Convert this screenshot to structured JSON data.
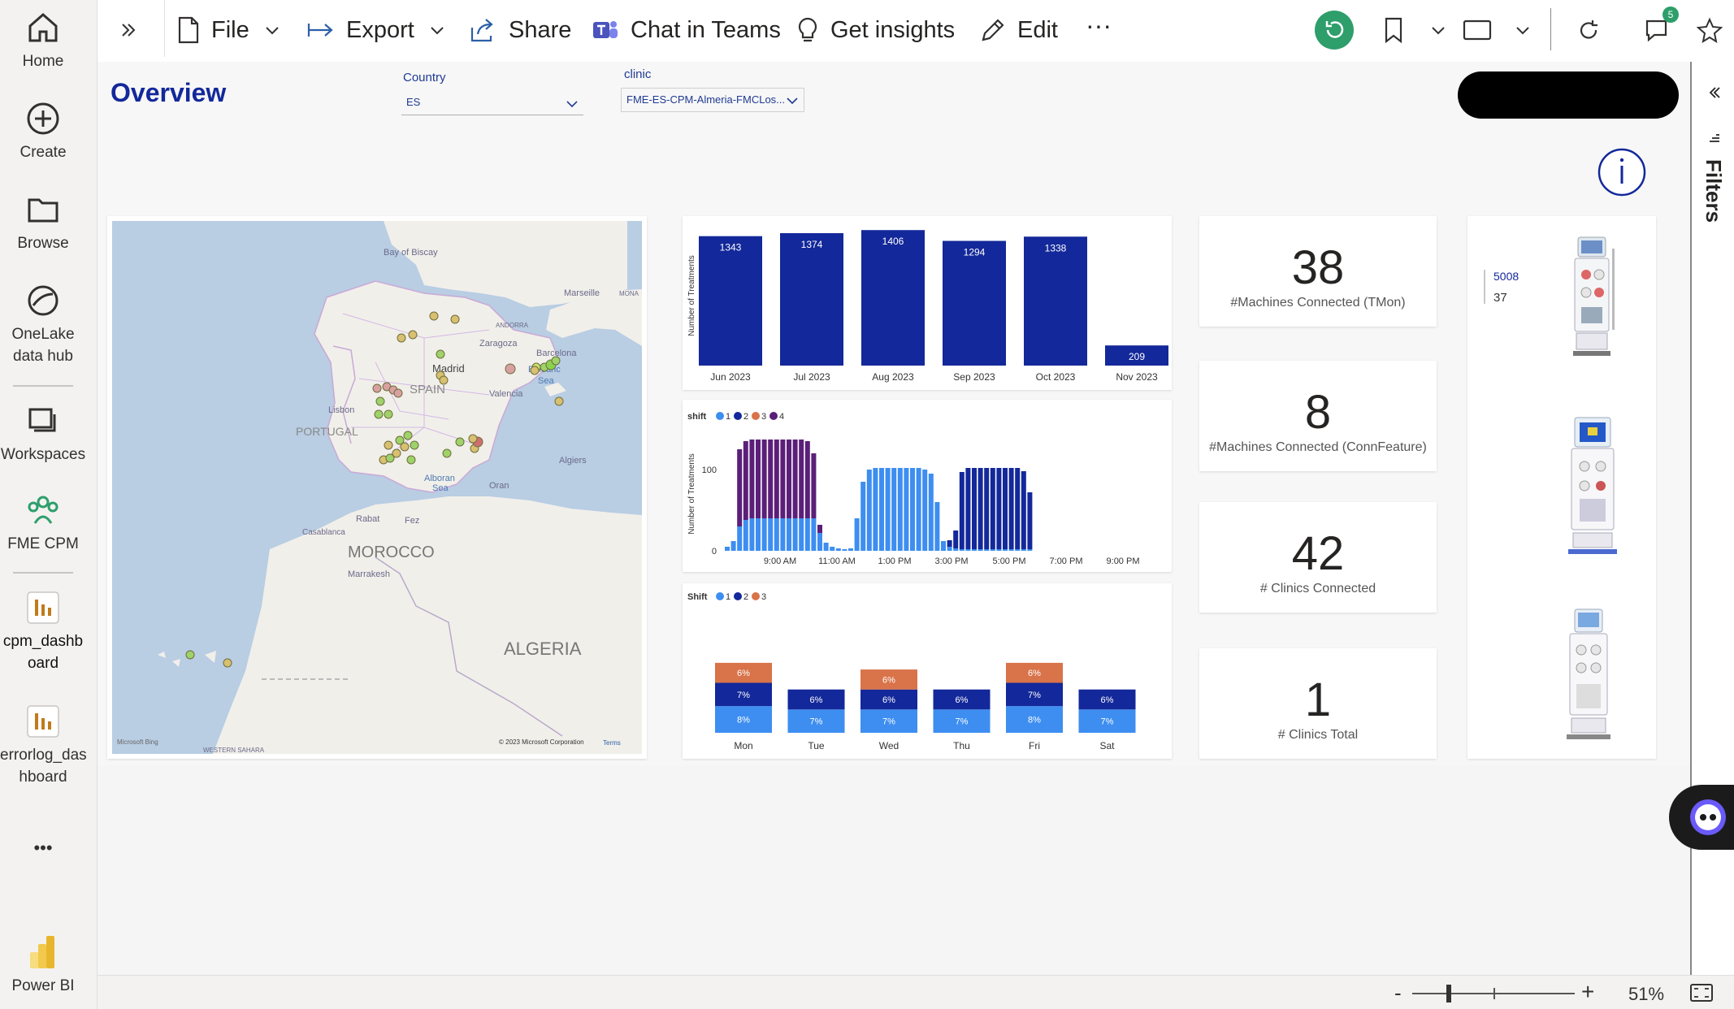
{
  "nav": {
    "home": "Home",
    "create": "Create",
    "browse": "Browse",
    "onelake": [
      "OneLake",
      "data hub"
    ],
    "workspaces": "Workspaces",
    "fme_cpm": "FME CPM",
    "cpm_dashboard": [
      "cpm_dashb",
      "oard"
    ],
    "errorlog": [
      "errorlog_das",
      "hboard"
    ],
    "more": "•••",
    "powerbi": "Power BI"
  },
  "toolbar": {
    "file": "File",
    "export": "Export",
    "share": "Share",
    "chat": "Chat in Teams",
    "insights": "Get insights",
    "edit": "Edit",
    "more": "···",
    "comments_badge": "5"
  },
  "report": {
    "title": "Overview",
    "country_label": "Country",
    "country_value": "ES",
    "clinic_label": "clinic",
    "clinic_value": "FME-ES-CPM-Almeria-FMCLos..."
  },
  "map": {
    "labels": [
      "Bay of Biscay",
      "Marseille",
      "MONA",
      "ANDORRA",
      "Zaragoza",
      "Barcelona",
      "Madrid",
      "SPAIN",
      "Balearic",
      "Sea",
      "Valencia",
      "Lisbon",
      "PORTUGAL",
      "Alboran",
      "Sea",
      "Algiers",
      "Oran",
      "Rabat",
      "Fez",
      "Casablanca",
      "MOROCCO",
      "Marrakesh",
      "ALGERIA",
      "WESTERN SAHARA"
    ],
    "attribution": "© 2023 Microsoft Corporation",
    "terms": "Terms",
    "bing": "Microsoft Bing"
  },
  "kpis": [
    {
      "value": "38",
      "label": "#Machines Connected (TMon)"
    },
    {
      "value": "8",
      "label": "#Machines Connected (ConnFeature)"
    },
    {
      "value": "42",
      "label": "# Clinics Connected"
    },
    {
      "value": "1",
      "label": "# Clinics Total"
    }
  ],
  "machines": {
    "model": "5008",
    "count": "37"
  },
  "statusbar": {
    "zoom": "51%",
    "minus": "-",
    "plus": "+"
  },
  "filters_label": "Filters",
  "colors": {
    "navy": "#13289a",
    "blue": "#3d8ef0",
    "purple": "#5b1f7a",
    "orange": "#d9734a",
    "accent_green": "#2e9e6b"
  },
  "chart_data": [
    {
      "type": "bar",
      "ylabel": "Number of Treatments",
      "categories": [
        "Jun 2023",
        "Jul 2023",
        "Aug 2023",
        "Sep 2023",
        "Oct 2023",
        "Nov 2023"
      ],
      "values": [
        1343,
        1374,
        1406,
        1294,
        1338,
        209
      ],
      "ylim": [
        0,
        1450
      ]
    },
    {
      "type": "bar",
      "stacked": true,
      "legend_title": "shift",
      "legend": [
        "1",
        "2",
        "3",
        "4"
      ],
      "ylabel": "Number of Treatments",
      "yticks": [
        "0",
        "100"
      ],
      "xticks": [
        "9:00 AM",
        "11:00 AM",
        "1:00 PM",
        "3:00 PM",
        "5:00 PM",
        "7:00 PM",
        "9:00 PM"
      ],
      "series": [
        {
          "name": "1",
          "color": "#3d8ef0",
          "values": [
            5,
            12,
            30,
            38,
            40,
            40,
            40,
            40,
            40,
            40,
            40,
            40,
            40,
            40,
            40,
            22,
            10,
            5,
            3,
            2,
            3,
            40,
            85,
            100,
            102,
            102,
            102,
            102,
            102,
            102,
            102,
            102,
            100,
            95,
            60,
            12,
            5,
            3,
            2,
            2,
            2,
            2,
            2,
            2,
            2,
            2,
            2,
            2,
            2,
            2
          ]
        },
        {
          "name": "2",
          "color": "#13289a",
          "values": [
            0,
            0,
            0,
            0,
            0,
            0,
            0,
            0,
            0,
            0,
            0,
            0,
            0,
            0,
            0,
            0,
            0,
            0,
            0,
            0,
            0,
            0,
            0,
            0,
            0,
            0,
            0,
            0,
            0,
            0,
            0,
            0,
            0,
            0,
            0,
            0,
            8,
            22,
            95,
            100,
            100,
            100,
            100,
            100,
            100,
            100,
            100,
            100,
            96,
            70,
            0
          ]
        },
        {
          "name": "3",
          "color": "#d9734a",
          "values": []
        },
        {
          "name": "4",
          "color": "#5b1f7a",
          "values": [
            0,
            0,
            95,
            97,
            97,
            97,
            97,
            97,
            97,
            97,
            97,
            97,
            97,
            95,
            80,
            10,
            0
          ]
        }
      ]
    },
    {
      "type": "bar",
      "stacked": true,
      "legend_title": "Shift",
      "legend": [
        "1",
        "2",
        "3"
      ],
      "categories": [
        "Mon",
        "Tue",
        "Wed",
        "Thu",
        "Fri",
        "Sat"
      ],
      "series": [
        {
          "name": "1",
          "color": "#3d8ef0",
          "labels": [
            "8%",
            "7%",
            "7%",
            "7%",
            "8%",
            "7%"
          ],
          "values": [
            8,
            7,
            7,
            7,
            8,
            7
          ]
        },
        {
          "name": "2",
          "color": "#13289a",
          "labels": [
            "7%",
            "6%",
            "6%",
            "6%",
            "7%",
            "6%"
          ],
          "values": [
            7,
            6,
            6,
            6,
            7,
            6
          ]
        },
        {
          "name": "3",
          "color": "#d9734a",
          "labels": [
            "6%",
            "",
            "6%",
            "",
            "6%",
            ""
          ],
          "values": [
            6,
            0,
            6,
            0,
            6,
            0
          ]
        }
      ]
    }
  ]
}
